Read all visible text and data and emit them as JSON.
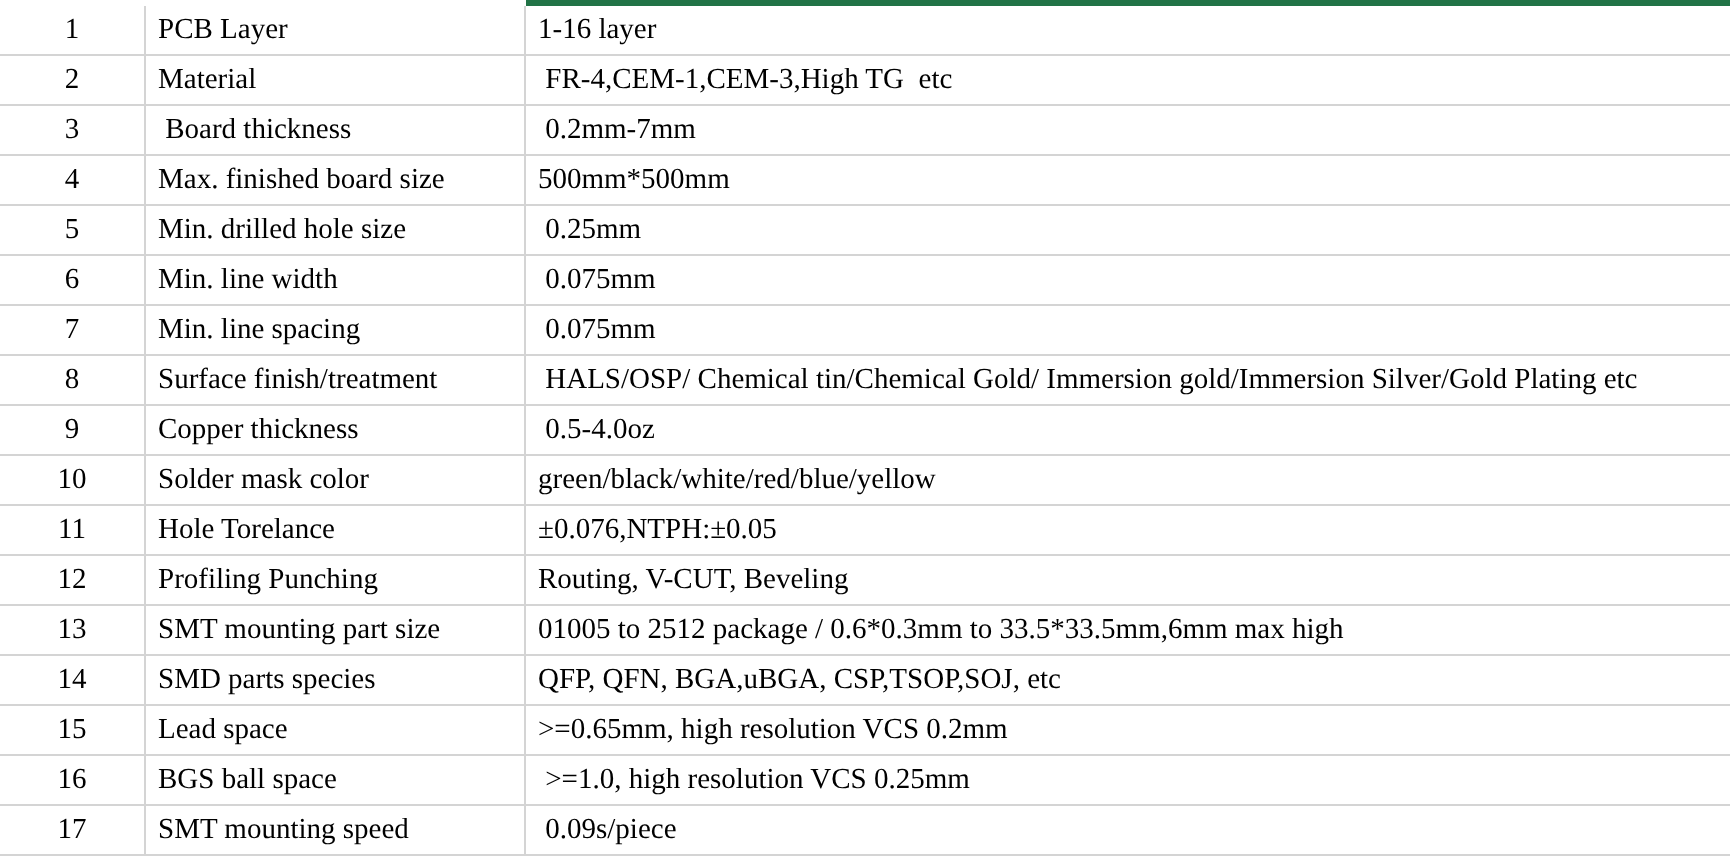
{
  "table": {
    "rows": [
      {
        "number": "1",
        "parameter": "PCB Layer",
        "value": "1-16 layer"
      },
      {
        "number": "2",
        "parameter": "Material",
        "value": " FR-4,CEM-1,CEM-3,High TG  etc"
      },
      {
        "number": "3",
        "parameter": " Board thickness",
        "value": " 0.2mm-7mm"
      },
      {
        "number": "4",
        "parameter": "Max. finished board size",
        "value": "500mm*500mm"
      },
      {
        "number": "5",
        "parameter": "Min. drilled hole size",
        "value": " 0.25mm"
      },
      {
        "number": "6",
        "parameter": "Min. line width",
        "value": " 0.075mm"
      },
      {
        "number": "7",
        "parameter": "Min. line spacing",
        "value": " 0.075mm"
      },
      {
        "number": "8",
        "parameter": "Surface finish/treatment",
        "value": " HALS/OSP/ Chemical tin/Chemical Gold/ Immersion gold/Immersion Silver/Gold Plating etc"
      },
      {
        "number": "9",
        "parameter": "Copper thickness",
        "value": " 0.5-4.0oz"
      },
      {
        "number": "10",
        "parameter": "Solder mask color",
        "value": "green/black/white/red/blue/yellow"
      },
      {
        "number": "11",
        "parameter": "Hole Torelance",
        "value": "±0.076,NTPH:±0.05"
      },
      {
        "number": "12",
        "parameter": "Profiling Punching",
        "value": "Routing, V-CUT, Beveling"
      },
      {
        "number": "13",
        "parameter": "SMT mounting part size",
        "value": "01005 to 2512 package / 0.6*0.3mm to 33.5*33.5mm,6mm max high"
      },
      {
        "number": "14",
        "parameter": "SMD parts species",
        "value": "QFP, QFN, BGA,uBGA, CSP,TSOP,SOJ, etc"
      },
      {
        "number": "15",
        "parameter": "Lead space",
        "value": ">=0.65mm, high resolution VCS 0.2mm"
      },
      {
        "number": "16",
        "parameter": "BGS ball space",
        "value": " >=1.0, high resolution VCS 0.25mm"
      },
      {
        "number": "17",
        "parameter": "SMT mounting speed",
        "value": " 0.09s/piece"
      }
    ]
  }
}
